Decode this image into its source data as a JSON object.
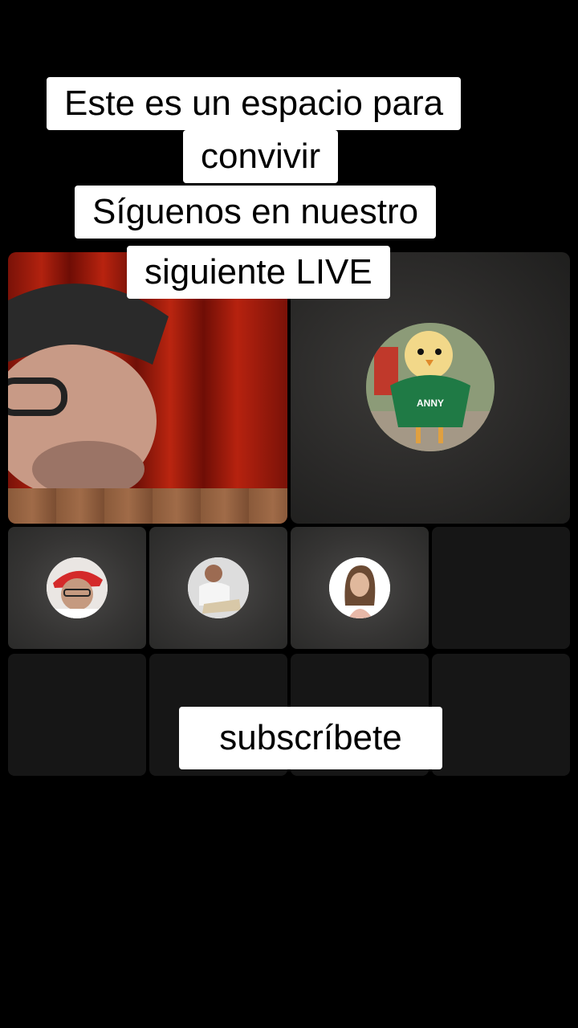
{
  "caption": {
    "line1": "Este es un espacio para",
    "line2": "convivir",
    "line3": "Síguenos en nuestro",
    "line4": "siguiente LIVE"
  },
  "subscribe_label": "subscríbete",
  "colors": {
    "background": "#000000",
    "caption_bg": "#ffffff",
    "caption_text": "#000000"
  },
  "participants": {
    "host": {
      "icon": "host-video-feed"
    },
    "guest_main": {
      "icon": "chick-avatar",
      "shirt_text": "ANNY"
    },
    "guests": [
      {
        "icon": "man-red-cap-avatar"
      },
      {
        "icon": "man-sitting-avatar"
      },
      {
        "icon": "woman-avatar"
      }
    ]
  }
}
